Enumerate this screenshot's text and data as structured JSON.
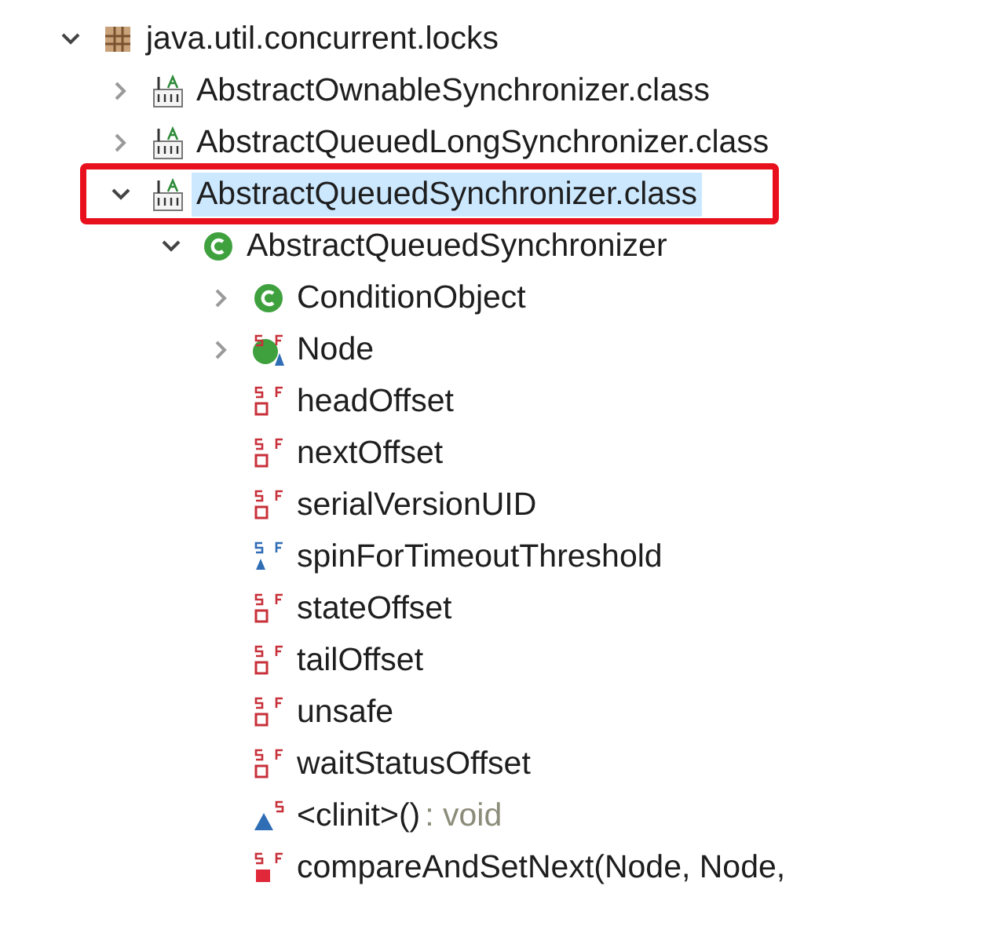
{
  "tree": [
    {
      "kind": "package",
      "label": "java.util.concurrent.locks",
      "expanded": true,
      "selected": false,
      "children": [
        {
          "kind": "classfile",
          "label": "AbstractOwnableSynchronizer.class",
          "expanded": false,
          "selected": false
        },
        {
          "kind": "classfile",
          "label": "AbstractQueuedLongSynchronizer.class",
          "expanded": false,
          "selected": false
        },
        {
          "kind": "classfile",
          "label": "AbstractQueuedSynchronizer.class",
          "expanded": true,
          "selected": true,
          "highlighted": true,
          "children": [
            {
              "kind": "class",
              "label": "AbstractQueuedSynchronizer",
              "expanded": true,
              "selected": false,
              "children": [
                {
                  "kind": "class",
                  "label": "ConditionObject",
                  "expanded": false,
                  "selected": false
                },
                {
                  "kind": "inner-class",
                  "label": "Node",
                  "expanded": false,
                  "selected": false
                },
                {
                  "kind": "private-field",
                  "label": "headOffset",
                  "selected": false
                },
                {
                  "kind": "private-field",
                  "label": "nextOffset",
                  "selected": false
                },
                {
                  "kind": "private-field",
                  "label": "serialVersionUID",
                  "selected": false
                },
                {
                  "kind": "default-field",
                  "label": "spinForTimeoutThreshold",
                  "selected": false
                },
                {
                  "kind": "private-field",
                  "label": "stateOffset",
                  "selected": false
                },
                {
                  "kind": "private-field",
                  "label": "tailOffset",
                  "selected": false
                },
                {
                  "kind": "private-field",
                  "label": "unsafe",
                  "selected": false
                },
                {
                  "kind": "private-field",
                  "label": "waitStatusOffset",
                  "selected": false
                },
                {
                  "kind": "static-method",
                  "label": "<clinit>()",
                  "return_type": " : void",
                  "selected": false
                },
                {
                  "kind": "private-method",
                  "label": "compareAndSetNext(Node, Node,",
                  "selected": false
                }
              ]
            }
          ]
        }
      ]
    }
  ]
}
